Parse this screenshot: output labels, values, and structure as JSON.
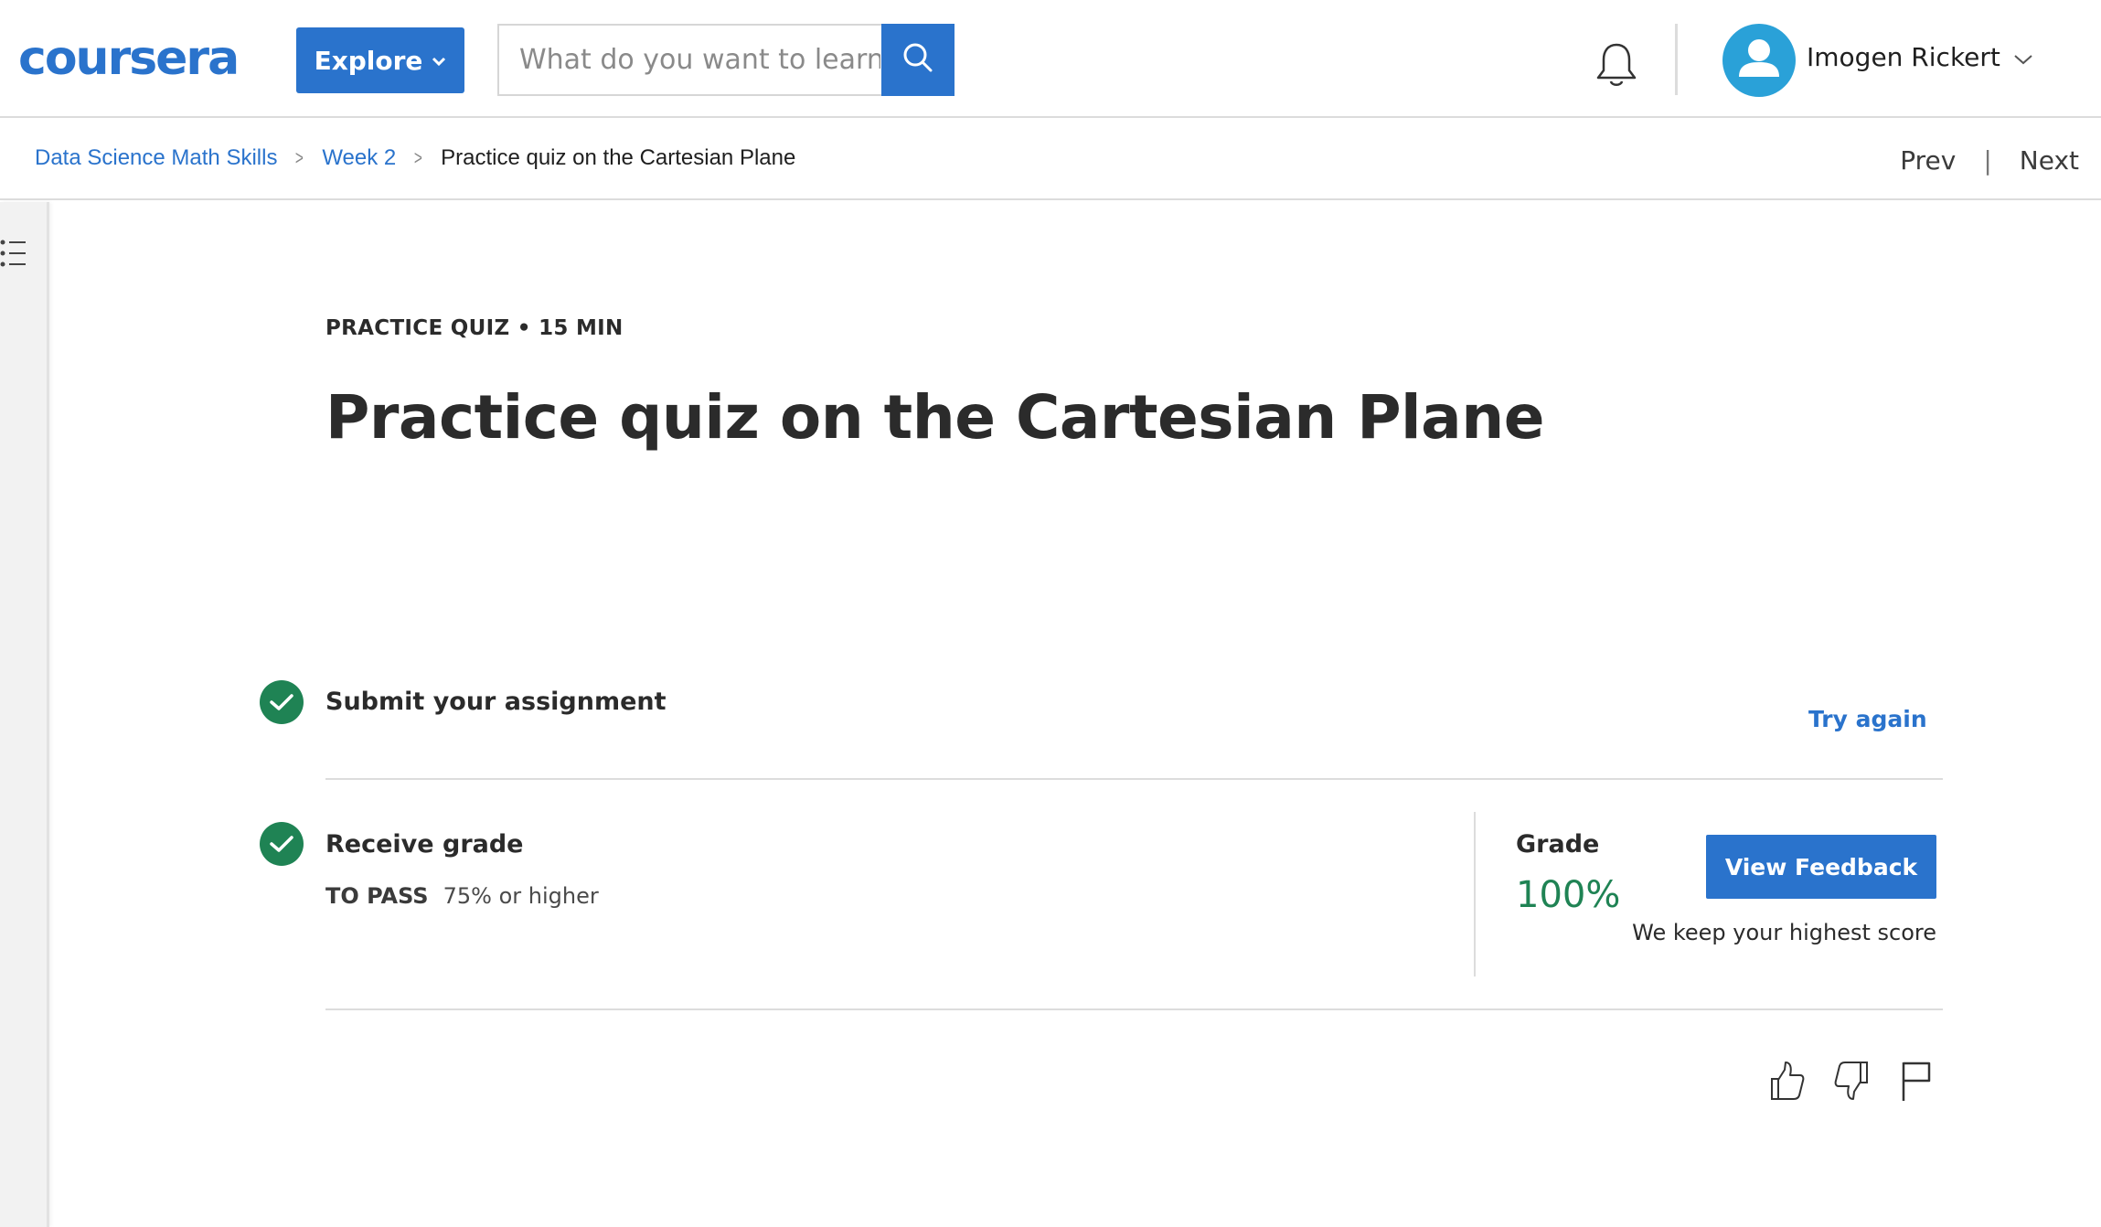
{
  "header": {
    "logo_text": "coursera",
    "explore_label": "Explore",
    "search_placeholder": "What do you want to learn?",
    "user_name": "Imogen Rickert",
    "brand_color": "#2a73cc"
  },
  "breadcrumb": {
    "items": [
      "Data Science Math Skills",
      "Week 2"
    ],
    "current": "Practice quiz on the Cartesian Plane"
  },
  "pager": {
    "prev_label": "Prev",
    "next_label": "Next"
  },
  "quiz": {
    "kicker": "PRACTICE QUIZ • 15 MIN",
    "title": "Practice quiz on the Cartesian Plane"
  },
  "submit_step": {
    "label": "Submit your assignment",
    "action_label": "Try again"
  },
  "grade_step": {
    "label": "Receive grade",
    "to_pass_key": "TO PASS",
    "to_pass_value": "75% or higher",
    "grade_label": "Grade",
    "grade_value": "100%",
    "grade_color": "#1f8354",
    "view_feedback_label": "View Feedback",
    "note": "We keep your highest score"
  },
  "icons": {
    "bell": "bell-icon",
    "search": "search-icon",
    "avatar": "user-avatar-icon",
    "menu": "list-menu-icon",
    "like": "thumbs-up-icon",
    "dislike": "thumbs-down-icon",
    "flag": "flag-icon"
  }
}
